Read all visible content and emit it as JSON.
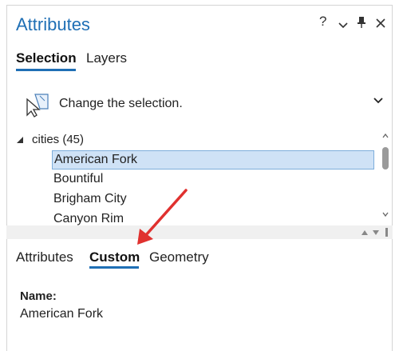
{
  "pane": {
    "title": "Attributes",
    "controls": {
      "help": "?",
      "menu": "⌄",
      "pin": "📌",
      "close": "✕"
    }
  },
  "top_tabs": [
    {
      "label": "Selection",
      "active": true
    },
    {
      "label": "Layers",
      "active": false
    }
  ],
  "selection_hint": {
    "text": "Change the selection.",
    "icon": "select-features-icon",
    "dropdown_icon": "chevron-down-icon"
  },
  "tree": {
    "root_label": "cities (45)",
    "items": [
      {
        "label": "American Fork",
        "selected": true
      },
      {
        "label": "Bountiful",
        "selected": false
      },
      {
        "label": "Brigham City",
        "selected": false
      },
      {
        "label": "Canyon Rim",
        "selected": false
      }
    ]
  },
  "bottom_tabs": [
    {
      "label": "Attributes",
      "active": false
    },
    {
      "label": "Custom",
      "active": true
    },
    {
      "label": "Geometry",
      "active": false
    }
  ],
  "detail": {
    "label": "Name:",
    "value": "American Fork"
  },
  "colors": {
    "accent": "#1f6fb5",
    "selection_fill": "#cfe2f6",
    "annotation_arrow": "#e0312f"
  }
}
